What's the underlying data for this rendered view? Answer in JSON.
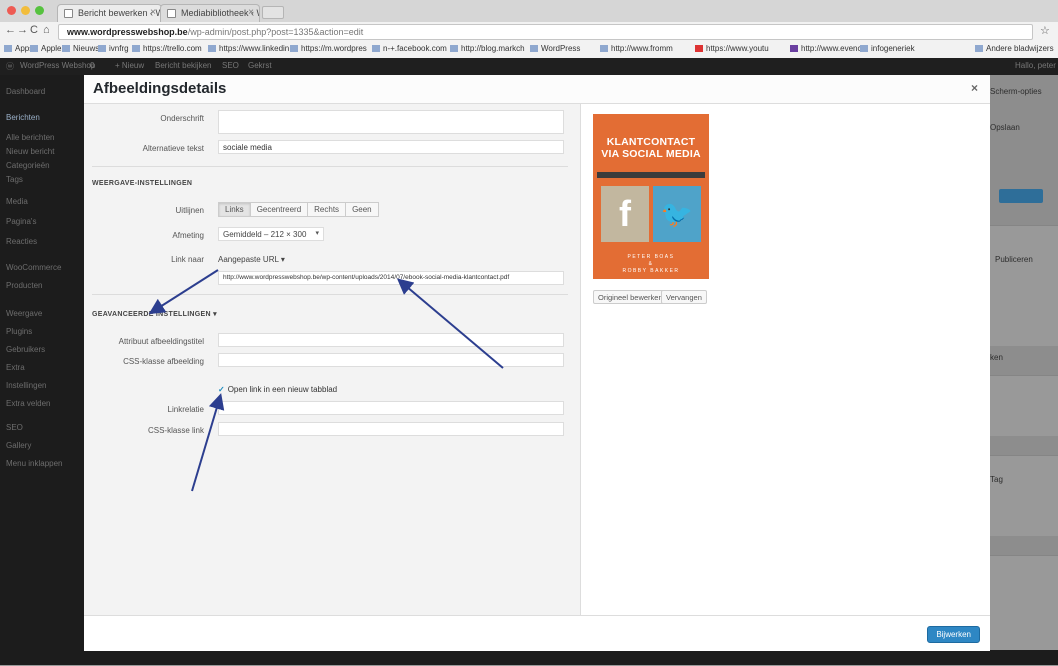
{
  "browser": {
    "tabs": [
      {
        "label": "Bericht bewerken ‹ Word",
        "active": true
      },
      {
        "label": "Mediabibliotheek ‹ Word",
        "active": false
      }
    ],
    "url_domain": "www.wordpresswebshop.be",
    "url_path": "/wp-admin/post.php?post=1335&action=edit",
    "bookmarks": [
      "Apps",
      "Apple",
      "Nieuws",
      "ivnfrg",
      "https://trello.com",
      "https://www.linkedin",
      "https://m.wordpres",
      "n-+.facebook.com",
      "http://blog.markch",
      "WordPress",
      "http://www.fromm",
      "https://www.youtu",
      "http://www.evenco",
      "infogeneriek",
      "Andere bladwijzers"
    ]
  },
  "admin": {
    "bar_items": [
      "WordPress Webshop",
      "0",
      "+ Nieuw",
      "Bericht bekijken",
      "SEO",
      "Gekrst"
    ],
    "bar_right": "Hallo, peter",
    "sidebar": [
      "Dashboard",
      "Berichten",
      "Alle berichten",
      "Nieuw bericht",
      "Categorieën",
      "Tags",
      "Media",
      "Pagina's",
      "Reacties",
      "WooCommerce",
      "Producten",
      "Weergave",
      "Plugins",
      "Gebruikers",
      "Extra",
      "Instellingen",
      "Extra velden",
      "SEO",
      "Gallery",
      "Menu inklappen"
    ],
    "right_texts": [
      "Scherm-opties",
      "Opslaan",
      "Bijwerken",
      "Publiceren",
      "ken",
      "Tag"
    ]
  },
  "modal": {
    "title": "Afbeeldingsdetails",
    "close": "×",
    "caption_label": "Onderschrift",
    "alt_label": "Alternatieve tekst",
    "alt_value": "sociale media",
    "display_section": "WEERGAVE-INSTELLINGEN",
    "align_label": "Uitlijnen",
    "align_options": [
      "Links",
      "Gecentreerd",
      "Rechts",
      "Geen"
    ],
    "align_selected": 0,
    "size_label": "Afmeting",
    "size_value": "Gemiddeld – 212 × 300",
    "link_label": "Link naar",
    "link_value": "Aangepaste URL",
    "link_url": "http://www.wordpresswebshop.be/wp-content/uploads/2014/07/ebook-social-media-klantcontact.pdf",
    "advanced_section": "GEAVANCEERDE INSTELLINGEN",
    "img_title_label": "Attribuut afbeeldingstitel",
    "img_css_label": "CSS-klasse afbeelding",
    "new_tab_label": "Open link in een nieuw tabblad",
    "new_tab_checked": true,
    "link_rel_label": "Linkrelatie",
    "link_css_label": "CSS-klasse link",
    "edit_original": "Origineel bewerken",
    "replace": "Vervangen",
    "update": "Bijwerken"
  },
  "cover": {
    "title_line1": "KLANTCONTACT",
    "title_line2": "VIA SOCIAL MEDIA",
    "facebook_glyph": "f",
    "twitter_glyph": "🐦",
    "author_line1": "PETER BOAS",
    "author_line2": "&",
    "author_line3": "ROBBY BAKKER"
  },
  "colors": {
    "accent": "#2e87c4",
    "cover_orange": "#e36d34",
    "arrow": "#2c3e8f"
  }
}
